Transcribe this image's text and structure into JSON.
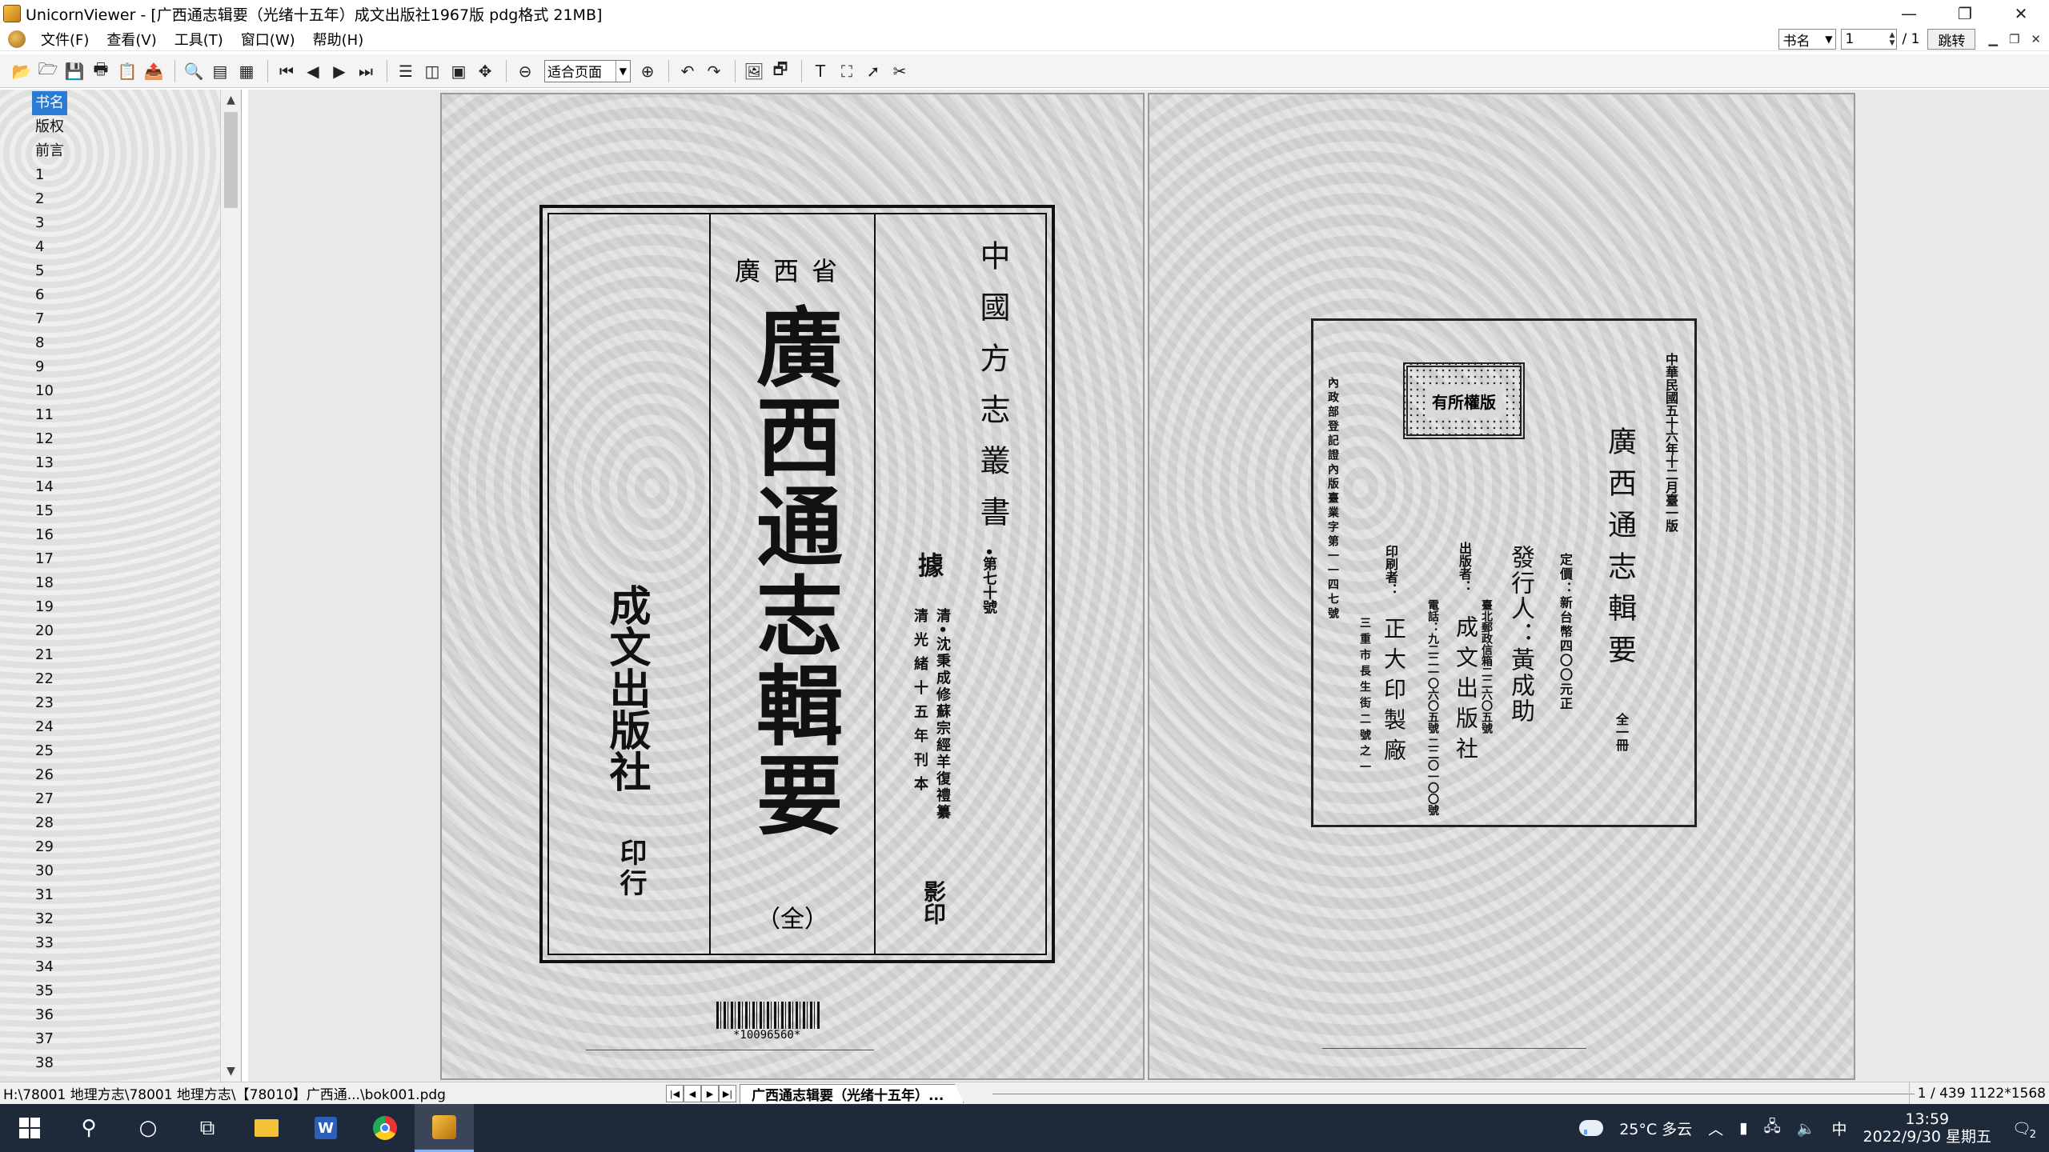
{
  "window": {
    "title": "UnicornViewer - [广西通志辑要（光绪十五年）成文出版社1967版 pdg格式 21MB]",
    "controls": [
      "—",
      "❐",
      "✕"
    ]
  },
  "menu": {
    "items": [
      "文件(F)",
      "查看(V)",
      "工具(T)",
      "窗口(W)",
      "帮助(H)"
    ],
    "bookmark_select": "书名",
    "page_input": "1",
    "page_total": "/ 1",
    "jump_label": "跳转"
  },
  "toolbar": {
    "zoom_value": "适合页面"
  },
  "sidebar": {
    "items": [
      "书名",
      "版权",
      "前言",
      "1",
      "2",
      "3",
      "4",
      "5",
      "6",
      "7",
      "8",
      "9",
      "10",
      "11",
      "12",
      "13",
      "14",
      "15",
      "16",
      "17",
      "18",
      "19",
      "20",
      "21",
      "22",
      "23",
      "24",
      "25",
      "26",
      "27",
      "28",
      "29",
      "30",
      "31",
      "32",
      "33",
      "34",
      "35",
      "36",
      "37",
      "38"
    ],
    "selected_index": 0
  },
  "left_page": {
    "series": "中國方志叢書",
    "series_no": "•第七十號",
    "province": "廣西省",
    "book_title": "廣西通志輯要",
    "volume": "（全）",
    "source_label": "據",
    "source_line1": "清•沈秉成修蘇宗經羊復禮纂",
    "source_line2": "清光緒十五年刊本",
    "reprint": "影印",
    "publisher": "成文出版社",
    "publisher_suffix": "印行",
    "barcode_number": "*10096560*"
  },
  "right_page": {
    "date": "中華民國五十六年十二月臺一版",
    "title": "廣西通志輯要",
    "volume": "全一冊",
    "price": "定價：新台幣四〇〇元正",
    "issuer": "發行人：黃成助",
    "publisher_label": "出版者：",
    "publisher_name": "成文出版社",
    "publisher_addr": "臺北郵政信箱二二六〇五號",
    "phone": "電話：九二二一〇六〇五號 二二〇一〇〇號",
    "printer_label": "印刷者：",
    "printer_name": "正大印製廠",
    "printer_addr": "三重市長生街二號之一",
    "license": "內政部登記證內版臺業字第一一四七號",
    "copyright_stamp": "有所權版"
  },
  "statusbar": {
    "path": "H:\\78001 地理方志\\78001 地理方志\\【78010】广西通...\\bok001.pdg",
    "doc_tab": "广西通志辑要（光绪十五年）...",
    "page_info": "1 / 439 1122*1568"
  },
  "taskbar": {
    "weather": "25°C 多云",
    "ime": "中",
    "time": "13:59",
    "date": "2022/9/30 星期五",
    "notifications": "2"
  },
  "colors": {
    "selection": "#2a7bd6",
    "taskbar": "#1e2a3a",
    "page_bg": "#d9d9d9"
  }
}
